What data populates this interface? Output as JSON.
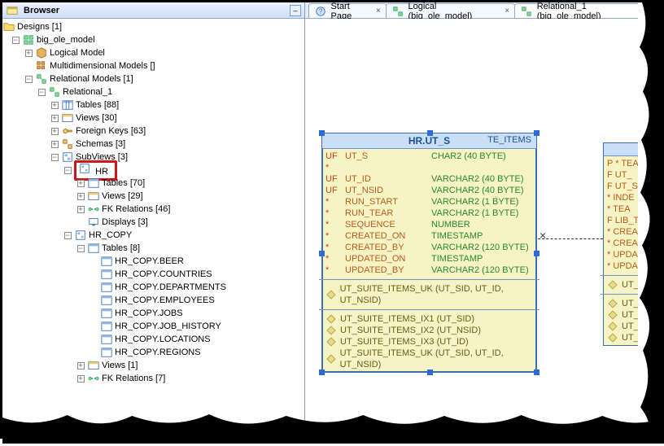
{
  "browser": {
    "title": "Browser",
    "root": "Designs [1]",
    "model": "big_ole_model",
    "nodes": {
      "logicalModel": "Logical Model",
      "multidimensional": "Multidimensional Models []",
      "relationalModels": "Relational Models [1]",
      "relational1": "Relational_1",
      "tables88": "Tables [88]",
      "views30": "Views [30]",
      "foreignKeys63": "Foreign Keys [63]",
      "schemas3": "Schemas [3]",
      "subviews3": "SubViews [3]",
      "hr": "HR",
      "hrTables70": "Tables [70]",
      "hrViews29": "Views [29]",
      "hrFK46": "FK Relations [46]",
      "hrDisplays3": "Displays [3]",
      "hrCopy": "HR_COPY",
      "hrCopyTables8": "Tables [8]",
      "t_beer": "HR_COPY.BEER",
      "t_countries": "HR_COPY.COUNTRIES",
      "t_departments": "HR_COPY.DEPARTMENTS",
      "t_employees": "HR_COPY.EMPLOYEES",
      "t_jobs": "HR_COPY.JOBS",
      "t_jobhist": "HR_COPY.JOB_HISTORY",
      "t_locations": "HR_COPY.LOCATIONS",
      "t_regions": "HR_COPY.REGIONS",
      "hrCopyViews1": "Views [1]",
      "hrCopyFK7": "FK Relations [7]"
    }
  },
  "tabs": {
    "start": "Start Page",
    "logical": "Logical (big_ole_model)",
    "relational": "Relational_1 (big_ole_model)"
  },
  "entity": {
    "title": "HR.UT_S",
    "title_suffix": "TE_ITEMS",
    "cols": [
      {
        "flag": "UF *",
        "name": "UT_S",
        "type": "CHAR2 (40 BYTE)"
      },
      {
        "flag": "UF",
        "name": "UT_ID",
        "type": "VARCHAR2 (40 BYTE)"
      },
      {
        "flag": "UF",
        "name": "UT_NSID",
        "type": "VARCHAR2 (40 BYTE)"
      },
      {
        "flag": "*",
        "name": "RUN_START",
        "type": "VARCHAR2 (1 BYTE)"
      },
      {
        "flag": "*",
        "name": "RUN_TEAR",
        "type": "VARCHAR2 (1 BYTE)"
      },
      {
        "flag": "*",
        "name": "SEQUENCE",
        "type": "NUMBER"
      },
      {
        "flag": "*",
        "name": "CREATED_ON",
        "type": "TIMESTAMP"
      },
      {
        "flag": "*",
        "name": "CREATED_BY",
        "type": "VARCHAR2 (120 BYTE)"
      },
      {
        "flag": "*",
        "name": "UPDATED_ON",
        "type": "TIMESTAMP"
      },
      {
        "flag": "*",
        "name": "UPDATED_BY",
        "type": "VARCHAR2 (120 BYTE)"
      }
    ],
    "uk": "UT_SUITE_ITEMS_UK (UT_SID, UT_ID, UT_NSID)",
    "idx": [
      "UT_SUITE_ITEMS_IX1 (UT_SID)",
      "UT_SUITE_ITEMS_IX2 (UT_NSID)",
      "UT_SUITE_ITEMS_IX3 (UT_ID)",
      "UT_SUITE_ITEMS_UK (UT_SID, UT_ID, UT_NSID)"
    ]
  },
  "entity2": {
    "rows": [
      "P *  TEA",
      "F    UT_",
      "F    UT_SI",
      "   * INDE",
      "   * TEA",
      "F    LIB_T",
      "   * CREA",
      "   * CREA",
      "   * UPDA",
      "   * UPDA"
    ],
    "uk": "UT_",
    "idx": [
      "UT_T",
      "UT_T",
      "UT_T",
      "UT_T"
    ]
  }
}
